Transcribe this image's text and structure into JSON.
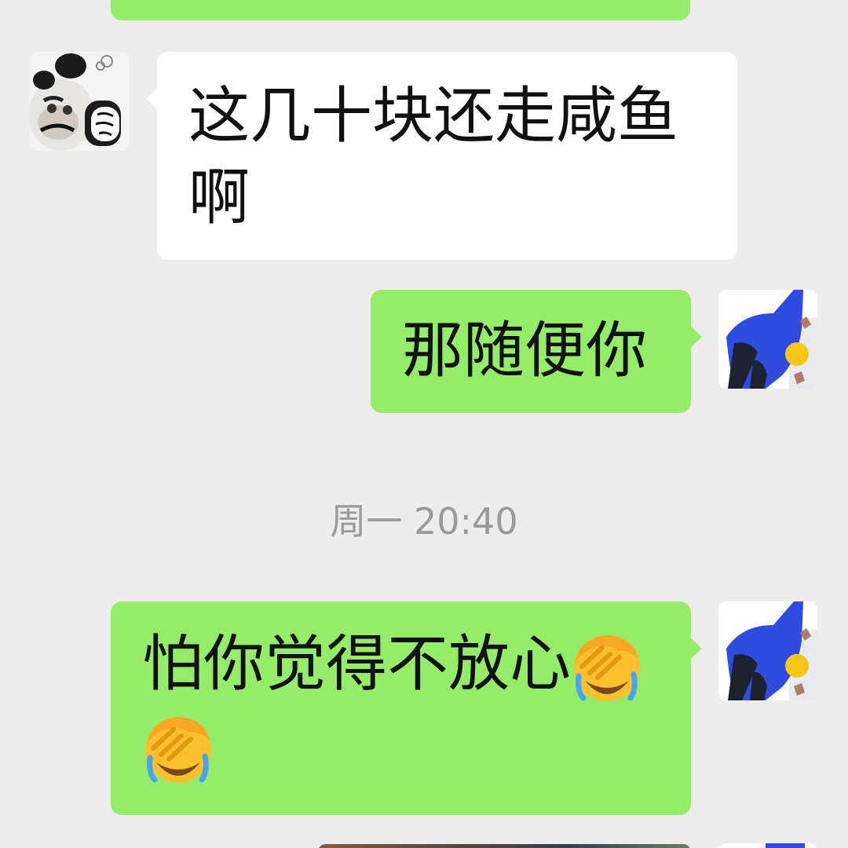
{
  "chat": {
    "messages": [
      {
        "side": "in",
        "text_line1": "这几十块还走咸鱼",
        "text_line2": "啊"
      },
      {
        "side": "out",
        "text": "那随便你"
      },
      {
        "side": "out",
        "text": "怕你觉得不放心",
        "emojis": [
          "face-palm-crying-emoji",
          "face-palm-crying-emoji"
        ]
      }
    ],
    "timestamp": "周一 20:40"
  },
  "colors": {
    "background": "#ededed",
    "incoming_bubble": "#ffffff",
    "outgoing_bubble": "#95ec69",
    "timestamp_text": "#9a9a9a",
    "avatar_me_blue": "#2f4be0",
    "avatar_me_yellow": "#f5c518"
  },
  "icons": {
    "contact_avatar": "panda-meme-avatar",
    "my_avatar": "blue-figure-avatar",
    "emoji": "face-palm-crying-emoji"
  }
}
